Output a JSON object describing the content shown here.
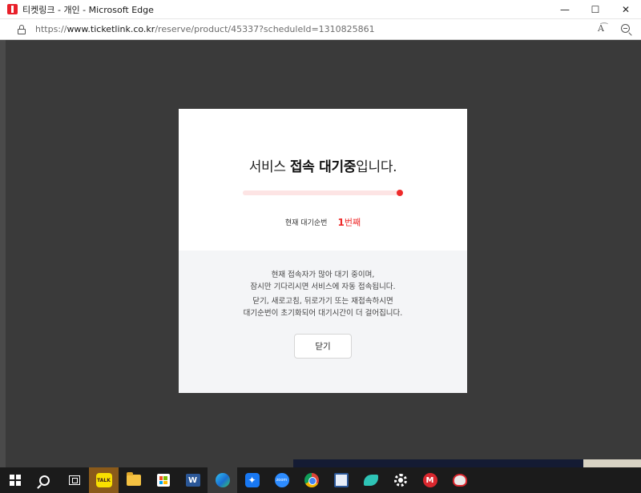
{
  "window": {
    "title": "티켓링크 - 개인 - Microsoft Edge",
    "controls": {
      "minimize": "—",
      "maximize": "☐",
      "close": "✕"
    }
  },
  "address_bar": {
    "url_scheme": "https://",
    "url_host": "www.ticketlink.co.kr",
    "url_path": "/reserve/product/45337?scheduleId=1310825861",
    "read_aloud": "A͡",
    "icons": [
      "lock-icon",
      "read-aloud-icon",
      "zoom-icon"
    ]
  },
  "modal": {
    "title_pre": "서비스 ",
    "title_bold": "접속 대기중",
    "title_post": "입니다.",
    "progress": 1.0,
    "queue_label": "현재 대기순번",
    "queue_number": "1",
    "queue_unit": "번째",
    "message1_line1": "현재 접속자가 많아 대기 중이며,",
    "message1_line2": "잠시만 기다리시면 서비스에 자동 접속됩니다.",
    "message2_line1": "닫기, 새로고침, 뒤로가기 또는 재접속하시면",
    "message2_line2": "대기순번이 초기화되어 대기시간이 더 걸어집니다.",
    "close_label": "닫기",
    "colors": {
      "accent": "#ee2a2a",
      "track": "#fdeaea",
      "bottom_bg": "#f4f5f7"
    }
  },
  "taskbar": {
    "items": [
      {
        "name": "start",
        "icon": "windows-icon"
      },
      {
        "name": "search",
        "icon": "search-icon"
      },
      {
        "name": "task-view",
        "icon": "task-view-icon"
      },
      {
        "name": "kakaotalk",
        "icon": "kakaotalk-icon",
        "label": "TALK"
      },
      {
        "name": "file-explorer",
        "icon": "folder-icon"
      },
      {
        "name": "store",
        "icon": "store-icon"
      },
      {
        "name": "word",
        "icon": "word-icon",
        "label": "W"
      },
      {
        "name": "edge",
        "icon": "edge-icon",
        "active": true
      },
      {
        "name": "app-blue",
        "icon": "blue-app-icon"
      },
      {
        "name": "zoom",
        "icon": "zoom-icon",
        "label": "zoom"
      },
      {
        "name": "chrome",
        "icon": "chrome-icon"
      },
      {
        "name": "notepad",
        "icon": "notepad-icon"
      },
      {
        "name": "bird-app",
        "icon": "bird-app-icon"
      },
      {
        "name": "settings",
        "icon": "gear-icon"
      },
      {
        "name": "mega",
        "icon": "mega-icon",
        "label": "M"
      },
      {
        "name": "misc-app",
        "icon": "misc-app-icon"
      }
    ]
  }
}
